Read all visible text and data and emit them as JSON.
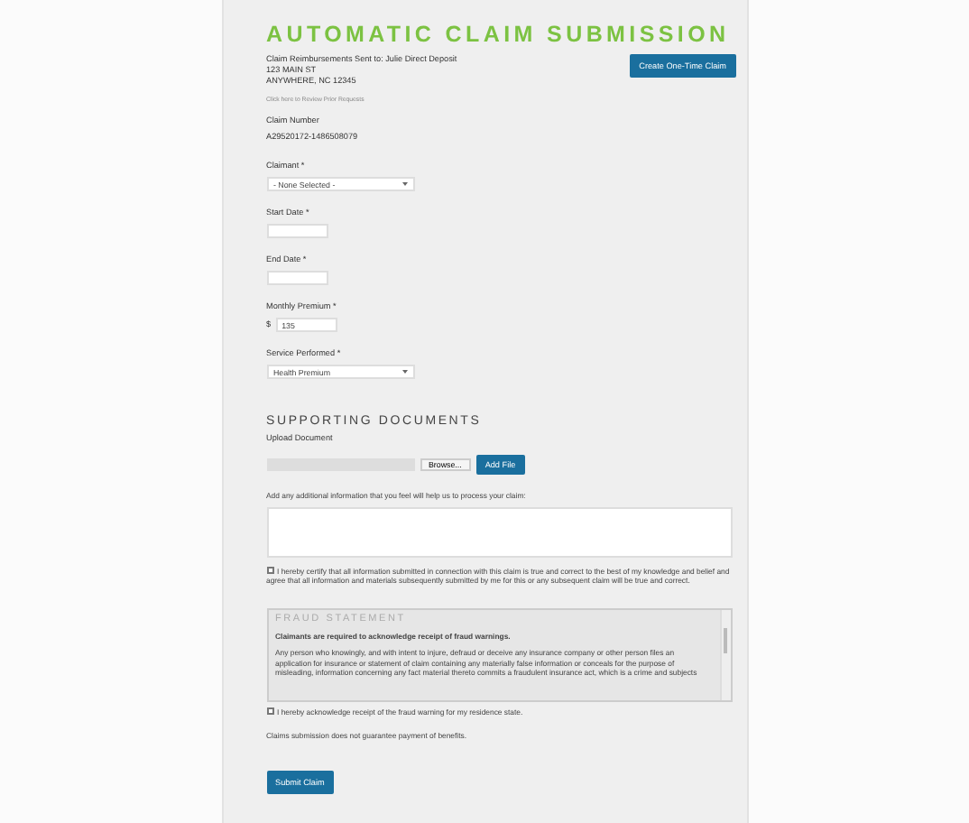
{
  "title": "AUTOMATIC CLAIM SUBMISSION",
  "address": [
    "Claim Reimbursements Sent to: Julie Direct Deposit",
    "123 MAIN ST",
    "ANYWHERE, NC 12345"
  ],
  "review_link": "Click here to Review Prior Requests",
  "create_button": "Create One-Time Claim",
  "claim_number": {
    "label": "Claim Number",
    "value": "A29520172-1486508079"
  },
  "fields": [
    {
      "kind": "select",
      "label": "Claimant *",
      "value": "- None Selected -"
    },
    {
      "kind": "date",
      "label": "Start Date *"
    },
    {
      "kind": "date",
      "label": "End Date *"
    },
    {
      "kind": "money",
      "label": "Monthly Premium *",
      "prefix": "$",
      "value": "135"
    },
    {
      "kind": "select",
      "label": "Service Performed *",
      "value": "Health Premium"
    }
  ],
  "documents": {
    "heading": "SUPPORTING DOCUMENTS",
    "upload_label": "Upload Document",
    "browse": "Browse...",
    "add_button": "Add File"
  },
  "info_label": "Add any additional information that you feel will help us to process your claim:",
  "certify": {
    "checked": false,
    "text": "I hereby certify that all information submitted in connection with this claim is true and correct to the best of my knowledge and belief and agree that all information and materials subsequently submitted by me for this or any subsequent claim will be true and correct."
  },
  "fraud": {
    "heading": "FRAUD STATEMENT",
    "lead": "Claimants are required to acknowledge receipt of fraud warnings.",
    "body": "Any person who knowingly, and with intent to injure, defraud or deceive any insurance company or other person files an application for insurance or statement of claim containing any materially false information or conceals for the purpose of misleading, information concerning any fact material thereto commits a fraudulent insurance act, which is a crime and subjects"
  },
  "acknowledge": {
    "checked": false,
    "text": "I hereby acknowledge receipt of the fraud warning for my residence state."
  },
  "disclaimer": "Claims submission does not guarantee payment of benefits.",
  "submit_button": "Submit Claim"
}
